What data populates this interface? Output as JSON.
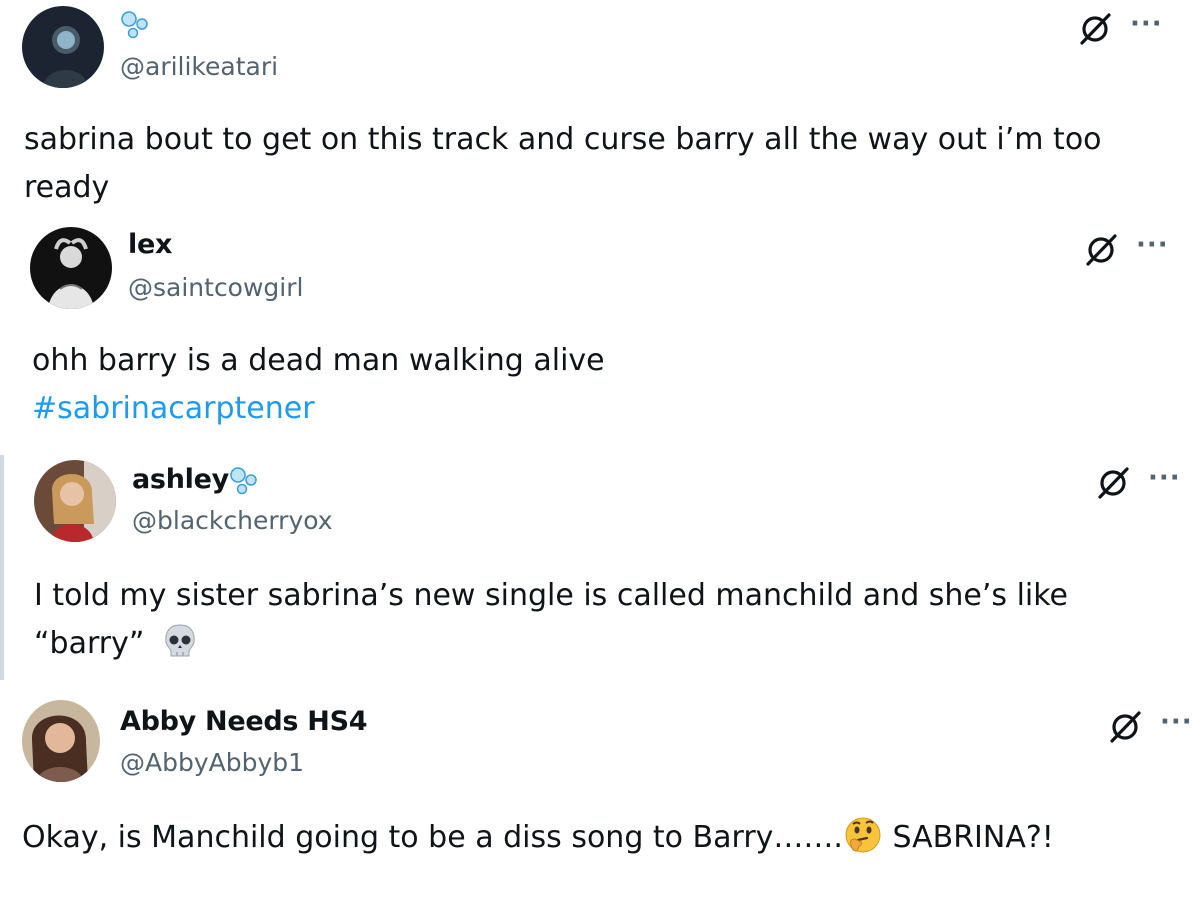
{
  "tweets": [
    {
      "display_name": "",
      "handle": "@arilikeatari",
      "text": "sabrina bout to get on this track and curse barry all the way out i’m too ready",
      "hashtag": "",
      "name_emoji": "bubbles-icon"
    },
    {
      "display_name": "lex",
      "handle": "@saintcowgirl",
      "text": "ohh barry is a dead man walking alive",
      "hashtag": "#sabrinacarptener"
    },
    {
      "display_name": "ashley",
      "handle": "@blackcherryox",
      "text_line1": "I told my sister sabrina’s new single is called manchild and she’s like",
      "text_line2": "“barry”",
      "text_emoji": "skull-icon",
      "name_emoji": "bubbles-icon"
    },
    {
      "display_name": "Abby Needs HS4",
      "handle": "@AbbyAbbyb1",
      "text_before": "Okay, is Manchild going to be a diss song to Barry…….",
      "text_emoji": "thinking-face-icon",
      "text_after": " SABRINA?!"
    }
  ],
  "actions": {
    "more_label": "···"
  },
  "colors": {
    "hashtag": "#1d9bf0",
    "handle": "#536471",
    "text": "#0f1419"
  }
}
